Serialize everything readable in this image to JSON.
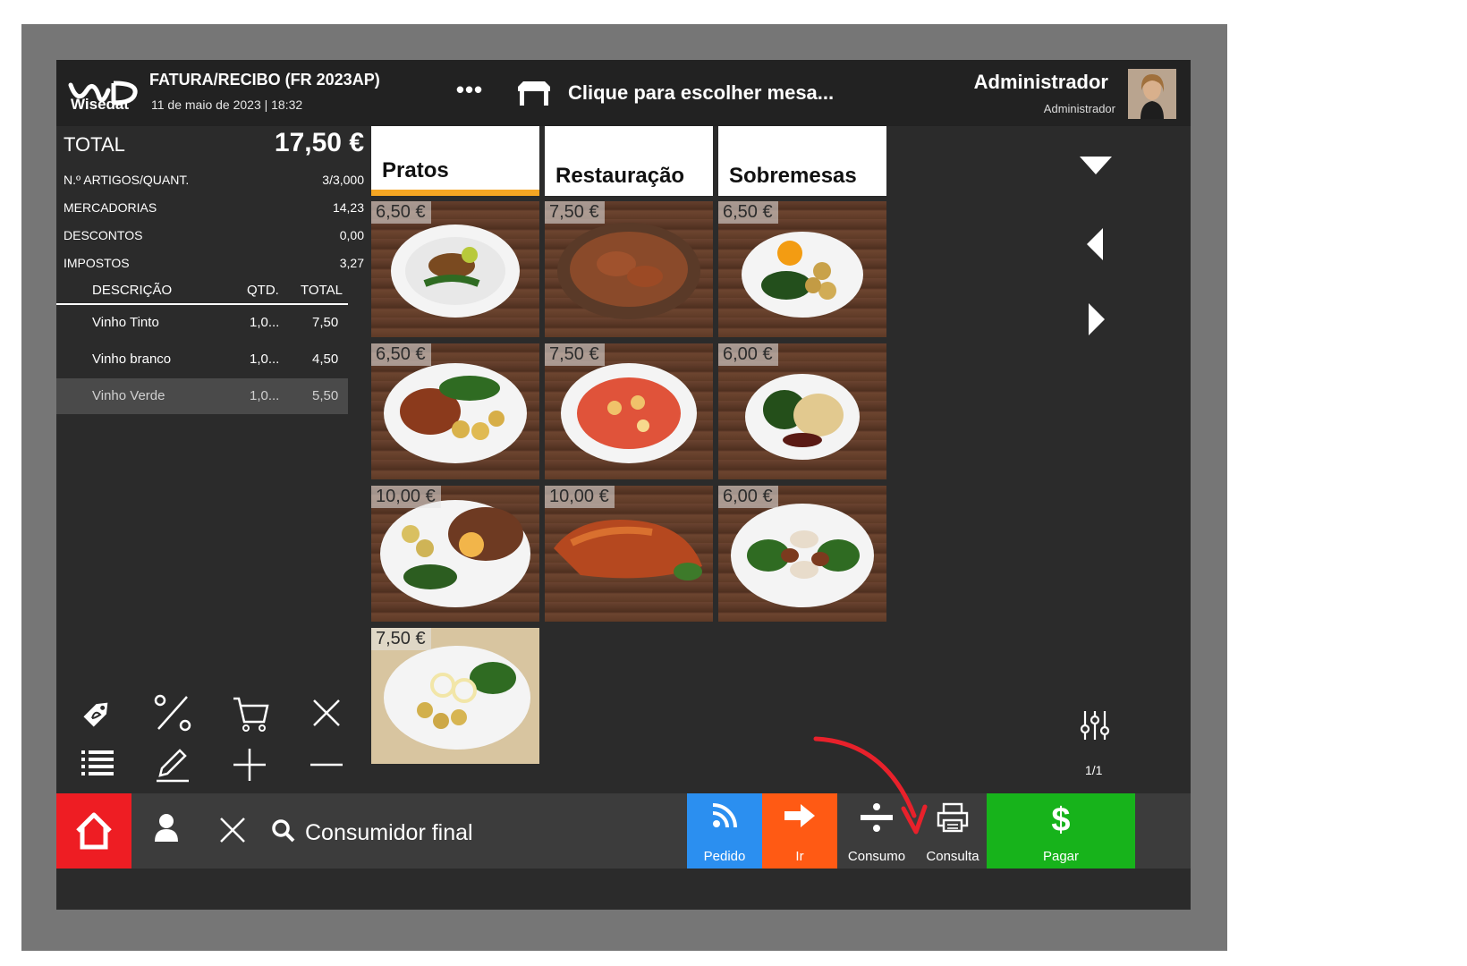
{
  "header": {
    "logo_text": "Wisedat",
    "doc_title": "FATURA/RECIBO (FR 2023AP)",
    "doc_date": "11 de maio de 2023 | 18:32",
    "more_label": "•••",
    "table_prompt": "Clique para escolher mesa...",
    "user_name": "Administrador",
    "user_role": "Administrador"
  },
  "summary": {
    "total_label": "TOTAL",
    "total_value": "17,50 €",
    "rows": [
      {
        "label": "N.º ARTIGOS/QUANT.",
        "value": "3/3,000"
      },
      {
        "label": "MERCADORIAS",
        "value": "14,23"
      },
      {
        "label": "DESCONTOS",
        "value": "0,00"
      },
      {
        "label": "IMPOSTOS",
        "value": "3,27"
      }
    ]
  },
  "lines": {
    "columns": {
      "desc": "DESCRIÇÃO",
      "qty": "QTD.",
      "total": "TOTAL"
    },
    "items": [
      {
        "desc": "Vinho Tinto",
        "qty": "1,0...",
        "total": "7,50",
        "selected": false
      },
      {
        "desc": "Vinho branco",
        "qty": "1,0...",
        "total": "4,50",
        "selected": false
      },
      {
        "desc": "Vinho Verde",
        "qty": "1,0...",
        "total": "5,50",
        "selected": true
      }
    ]
  },
  "tools": [
    "tag-icon",
    "percent-icon",
    "cart-icon",
    "close-icon",
    "list-icon",
    "pencil-icon",
    "plus-icon",
    "minus-icon"
  ],
  "categories": [
    {
      "label": "Pratos",
      "active": true
    },
    {
      "label": "Restauração",
      "active": false
    },
    {
      "label": "Sobremesas",
      "active": false
    }
  ],
  "products": [
    {
      "price": "6,50 €"
    },
    {
      "price": "7,50 €"
    },
    {
      "price": "6,50 €"
    },
    {
      "price": "6,50 €"
    },
    {
      "price": "7,50 €"
    },
    {
      "price": "6,00 €"
    },
    {
      "price": "10,00 €"
    },
    {
      "price": "10,00 €"
    },
    {
      "price": "6,00 €"
    },
    {
      "price": "7,50 €"
    }
  ],
  "pager": "1/1",
  "bottom": {
    "customer": "Consumidor final",
    "actions": {
      "pedido": "Pedido",
      "ir": "Ir",
      "consumo": "Consumo",
      "consulta": "Consulta",
      "pagar": "Pagar"
    }
  },
  "colors": {
    "home": "#ee1d23",
    "pedido": "#2b8ff0",
    "ir": "#ff5a14",
    "pagar": "#17b31b",
    "active_tab": "#f5a623",
    "annotation_arrow": "#e8212b"
  }
}
